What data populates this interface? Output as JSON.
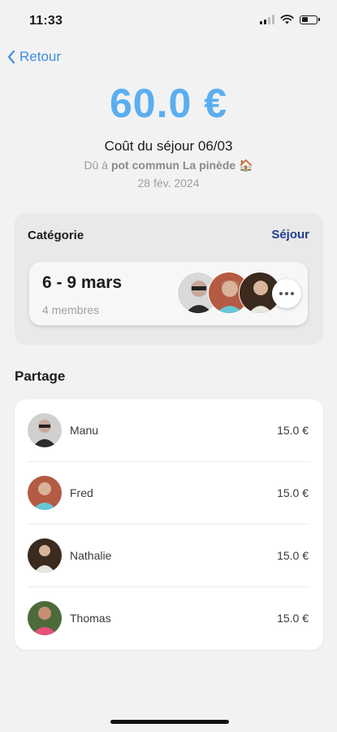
{
  "status": {
    "time": "11:33"
  },
  "nav": {
    "back_label": "Retour"
  },
  "expense": {
    "amount": "60.0 €",
    "title": "Coût du séjour 06/03",
    "due_prefix": "Dû à ",
    "due_to": "pot commun La pinède",
    "due_emoji": "🏠",
    "date": "28 fév. 2024"
  },
  "category": {
    "label": "Catégorie",
    "value": "Séjour",
    "stay": {
      "dates": "6 - 9 mars",
      "members": "4 membres"
    }
  },
  "share": {
    "title": "Partage",
    "rows": [
      {
        "name": "Manu",
        "amount": "15.0 €"
      },
      {
        "name": "Fred",
        "amount": "15.0 €"
      },
      {
        "name": "Nathalie",
        "amount": "15.0 €"
      },
      {
        "name": "Thomas",
        "amount": "15.0 €"
      }
    ]
  },
  "colors": {
    "accent": "#5aaef0",
    "link": "#3d8fe0",
    "category_link": "#1f3f8f"
  }
}
